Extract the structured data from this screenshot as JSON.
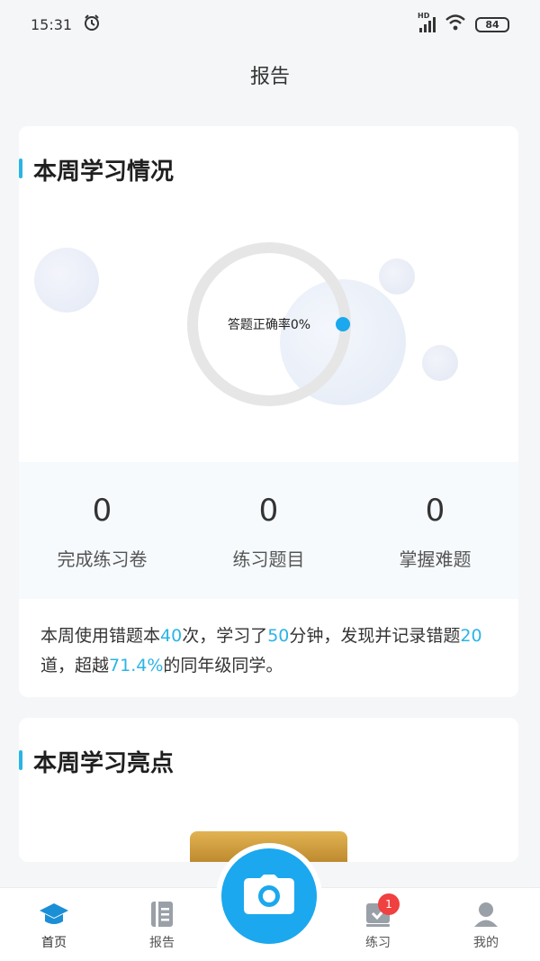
{
  "status_bar": {
    "time": "15:31",
    "battery": "84",
    "network": "HD"
  },
  "header": {
    "title": "报告"
  },
  "weekly_card": {
    "title": "本周学习情况",
    "ring_label": "答题正确率0%",
    "accuracy_percent": 0,
    "stats": [
      {
        "value": "0",
        "label": "完成练习卷"
      },
      {
        "value": "0",
        "label": "练习题目"
      },
      {
        "value": "0",
        "label": "掌握难题"
      }
    ],
    "summary": {
      "p1": "本周使用错题本",
      "v1": "40",
      "p2": "次，学习了",
      "v2": "50",
      "p3": "分钟，发现并记录错题",
      "v3": "20",
      "p4": "道，超越",
      "v4": "71.4%",
      "p5": "的同年级同学。"
    }
  },
  "highlight_card": {
    "title": "本周学习亮点"
  },
  "tabbar": {
    "items": [
      {
        "label": "首页"
      },
      {
        "label": "报告"
      },
      {
        "label": "练习",
        "badge": "1"
      },
      {
        "label": "我的"
      }
    ]
  },
  "colors": {
    "accent": "#2ab4e6",
    "camera": "#1ba8ee",
    "badge": "#f04040"
  },
  "icons": [
    "alarm-icon",
    "signal-icon",
    "wifi-icon",
    "battery-icon",
    "graduation-cap-icon",
    "notebook-icon",
    "camera-icon",
    "checklist-icon",
    "user-icon"
  ]
}
